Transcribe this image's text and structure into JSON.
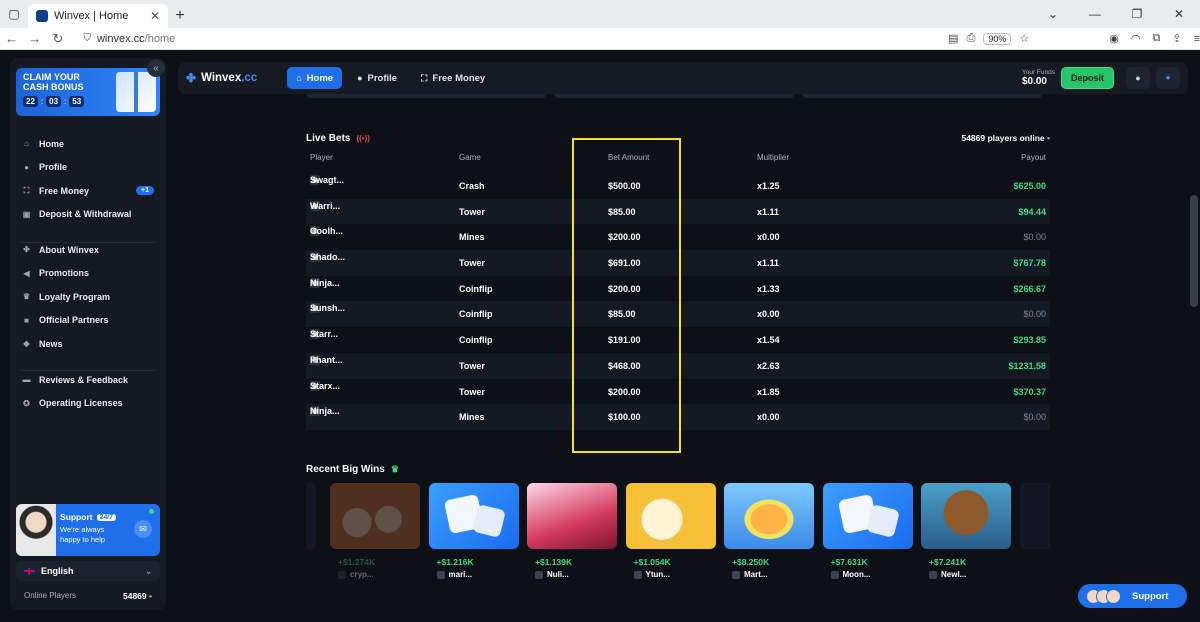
{
  "browser": {
    "tab_title": "Winvex | Home",
    "url_host": "winvex.cc",
    "url_path": "/home",
    "zoom": "90%"
  },
  "sidebar": {
    "claim": {
      "title": "CLAIM YOUR CASH BONUS",
      "timer": [
        "22",
        "03",
        "53"
      ]
    },
    "menu_main": [
      {
        "label": "Home",
        "icon": "home-icon"
      },
      {
        "label": "Profile",
        "icon": "user-icon"
      },
      {
        "label": "Free Money",
        "icon": "gift-icon",
        "badge": "+1"
      },
      {
        "label": "Deposit & Withdrawal",
        "icon": "wallet-icon"
      }
    ],
    "menu_info": [
      {
        "label": "About Winvex",
        "icon": "clover-icon"
      },
      {
        "label": "Promotions",
        "icon": "megaphone-icon"
      },
      {
        "label": "Loyalty Program",
        "icon": "trophy-icon"
      },
      {
        "label": "Official Partners",
        "icon": "briefcase-icon"
      },
      {
        "label": "News",
        "icon": "broadcast-icon"
      }
    ],
    "menu_trust": [
      {
        "label": "Reviews & Feedback",
        "icon": "chat-icon"
      },
      {
        "label": "Operating Licenses",
        "icon": "license-icon"
      }
    ],
    "support": {
      "title": "Support",
      "pill": "24/7",
      "text": "We're always happy to help"
    },
    "language": "English",
    "online_label": "Online Players",
    "online_value": "54869"
  },
  "topnav": {
    "brand": "Winvex",
    "brand_tld": ".cc",
    "home": "Home",
    "profile": "Profile",
    "free_money": "Free Money",
    "funds_label": "Your Funds",
    "funds_value": "$0.00",
    "deposit": "Deposit"
  },
  "live_bets": {
    "title": "Live Bets",
    "players_online": "54869 players online",
    "columns": [
      "Player",
      "Game",
      "Bet Amount",
      "Multiplier",
      "Payout"
    ],
    "rows": [
      {
        "player": "Swagt...",
        "game": "Crash",
        "bet": "$500.00",
        "mult": "x1.25",
        "payout": "$625.00",
        "win": true
      },
      {
        "player": "Warri...",
        "game": "Tower",
        "bet": "$85.00",
        "mult": "x1.11",
        "payout": "$94.44",
        "win": true
      },
      {
        "player": "Coolh...",
        "game": "Mines",
        "bet": "$200.00",
        "mult": "x0.00",
        "payout": "$0.00",
        "win": false
      },
      {
        "player": "Shado...",
        "game": "Tower",
        "bet": "$691.00",
        "mult": "x1.11",
        "payout": "$767.78",
        "win": true
      },
      {
        "player": "Ninja...",
        "game": "Coinflip",
        "bet": "$200.00",
        "mult": "x1.33",
        "payout": "$266.67",
        "win": true
      },
      {
        "player": "Sunsh...",
        "game": "Coinflip",
        "bet": "$85.00",
        "mult": "x0.00",
        "payout": "$0.00",
        "win": false
      },
      {
        "player": "Starr...",
        "game": "Coinflip",
        "bet": "$191.00",
        "mult": "x1.54",
        "payout": "$293.85",
        "win": true
      },
      {
        "player": "Phant...",
        "game": "Tower",
        "bet": "$468.00",
        "mult": "x2.63",
        "payout": "$1231.58",
        "win": true
      },
      {
        "player": "Starx...",
        "game": "Tower",
        "bet": "$200.00",
        "mult": "x1.85",
        "payout": "$370.37",
        "win": true
      },
      {
        "player": "Ninja...",
        "game": "Mines",
        "bet": "$100.00",
        "mult": "x0.00",
        "payout": "$0.00",
        "win": false
      }
    ]
  },
  "recent_wins": {
    "title": "Recent Big Wins",
    "items": [
      {
        "amount": "+$1.274K",
        "user": "cryp...",
        "theme": "orange",
        "faded": true
      },
      {
        "amount": "+$1.216K",
        "user": "mari...",
        "theme": "dice",
        "faded": false
      },
      {
        "amount": "+$1.139K",
        "user": "Nuli...",
        "theme": "anime",
        "faded": false
      },
      {
        "amount": "+$1.054K",
        "user": "Ytun...",
        "theme": "coin",
        "faded": false
      },
      {
        "amount": "+$8.250K",
        "user": "Mart...",
        "theme": "egg",
        "faded": false
      },
      {
        "amount": "+$7.631K",
        "user": "Moon...",
        "theme": "dice",
        "faded": false
      },
      {
        "amount": "+$7.241K",
        "user": "Newl...",
        "theme": "dog",
        "faded": false
      }
    ]
  },
  "support_fab": "Support"
}
